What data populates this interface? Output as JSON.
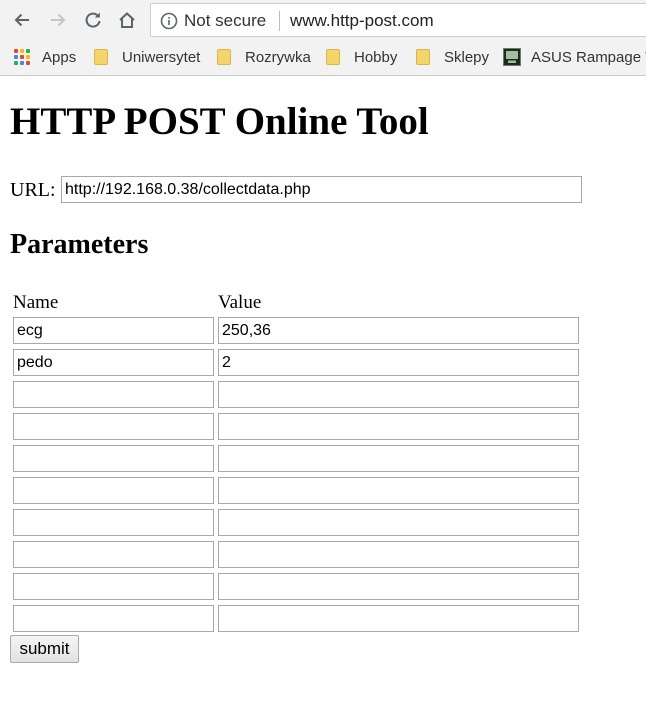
{
  "browser": {
    "security_label": "Not secure",
    "url": "www.http-post.com",
    "bookmarks": [
      {
        "label": "Apps",
        "icon": "apps-grid-icon"
      },
      {
        "label": "Uniwersytet",
        "icon": "folder-icon"
      },
      {
        "label": "Rozrywka",
        "icon": "folder-icon"
      },
      {
        "label": "Hobby",
        "icon": "folder-icon"
      },
      {
        "label": "Sklepy",
        "icon": "folder-icon"
      },
      {
        "label": "ASUS Rampage V",
        "icon": "asus-pc-icon"
      }
    ]
  },
  "page": {
    "title": "HTTP POST Online Tool",
    "url_label": "URL:",
    "url_value": "http://192.168.0.38/collectdata.php",
    "parameters_heading": "Parameters",
    "columns": {
      "name": "Name",
      "value": "Value"
    },
    "parameters": [
      {
        "name": "ecg",
        "value": "250,36"
      },
      {
        "name": "pedo",
        "value": "2"
      },
      {
        "name": "",
        "value": ""
      },
      {
        "name": "",
        "value": ""
      },
      {
        "name": "",
        "value": ""
      },
      {
        "name": "",
        "value": ""
      },
      {
        "name": "",
        "value": ""
      },
      {
        "name": "",
        "value": ""
      },
      {
        "name": "",
        "value": ""
      },
      {
        "name": "",
        "value": ""
      }
    ],
    "submit_label": "submit"
  },
  "colors": {
    "chrome_bg": "#f2f2f2",
    "folder": "#f6d46c",
    "input_border": "#a9a9a9"
  }
}
